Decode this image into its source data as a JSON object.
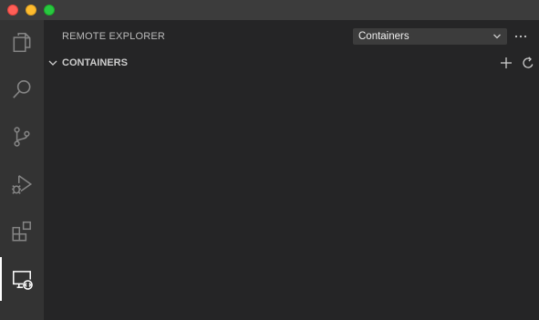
{
  "window": {
    "controls": [
      "close",
      "minimize",
      "maximize"
    ]
  },
  "activity_bar": {
    "items": [
      {
        "name": "explorer",
        "icon": "files-icon",
        "active": false
      },
      {
        "name": "search",
        "icon": "search-icon",
        "active": false
      },
      {
        "name": "source-control",
        "icon": "source-control-icon",
        "active": false
      },
      {
        "name": "run-and-debug",
        "icon": "run-debug-icon",
        "active": false
      },
      {
        "name": "extensions",
        "icon": "extensions-icon",
        "active": false
      },
      {
        "name": "remote-explorer",
        "icon": "remote-explorer-icon",
        "active": true
      }
    ]
  },
  "sidebar": {
    "title": "REMOTE EXPLORER",
    "view_select": {
      "selected": "Containers"
    },
    "more_actions_icon": "ellipsis-icon",
    "section": {
      "title": "CONTAINERS",
      "expanded": true,
      "actions": [
        "add-icon",
        "refresh-icon"
      ]
    }
  },
  "colors": {
    "titlebar": "#3c3c3c",
    "activity_bar": "#333333",
    "sidebar": "#252526",
    "close": "#ff5f57",
    "minimize": "#febc2e",
    "maximize": "#28c840",
    "icon_inactive": "#858585",
    "icon_active": "#ffffff",
    "text": "#cccccc"
  }
}
